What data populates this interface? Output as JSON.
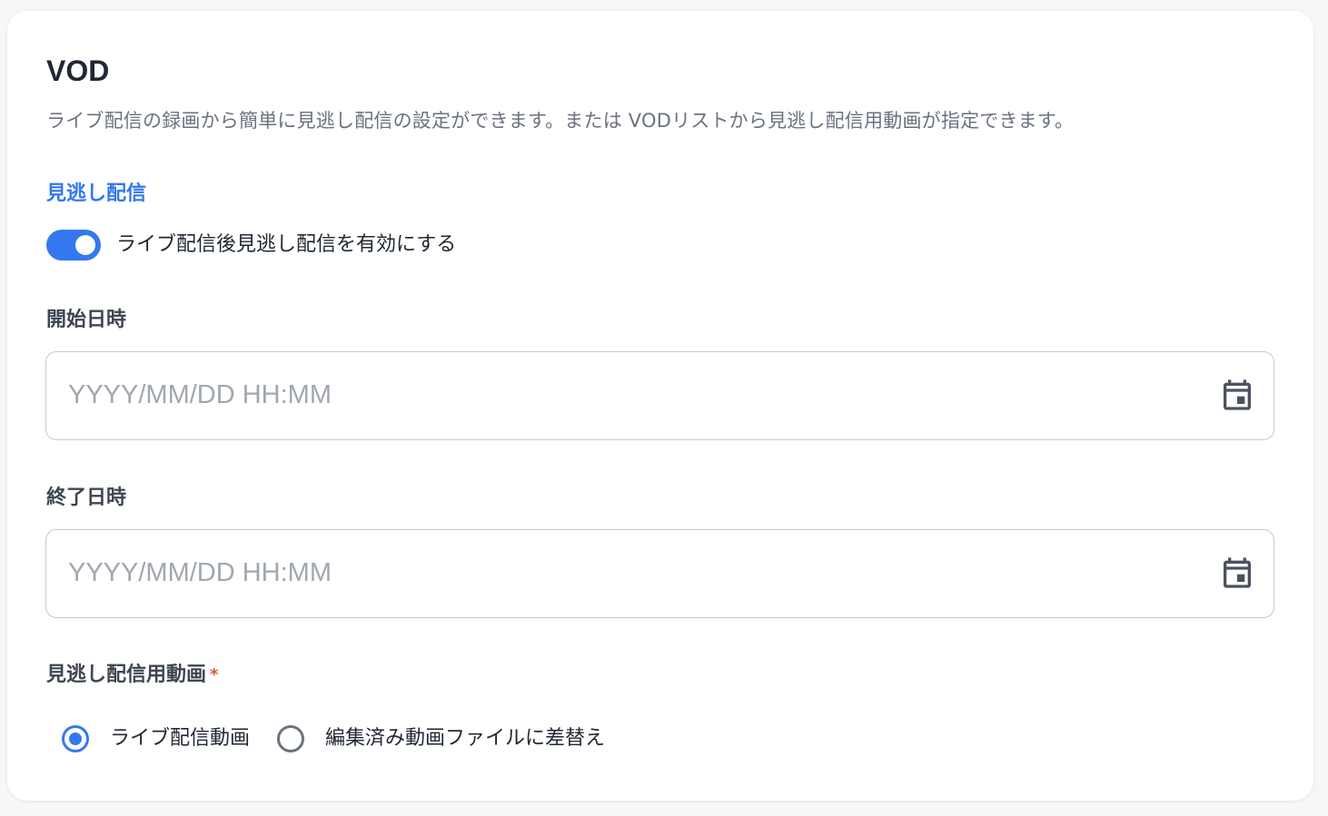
{
  "vod": {
    "title": "VOD",
    "description": "ライブ配信の録画から簡単に見逃し配信の設定ができます。または VODリストから見逃し配信用動画が指定できます。"
  },
  "catchup": {
    "section_label": "見逃し配信",
    "toggle_label": "ライブ配信後見逃し配信を有効にする",
    "toggle_on": true
  },
  "start": {
    "label": "開始日時",
    "placeholder": "YYYY/MM/DD HH:MM",
    "value": ""
  },
  "end": {
    "label": "終了日時",
    "placeholder": "YYYY/MM/DD HH:MM",
    "value": ""
  },
  "video": {
    "label": "見逃し配信用動画",
    "required_mark": "*",
    "options": [
      {
        "label": "ライブ配信動画",
        "selected": true
      },
      {
        "label": "編集済み動画ファイルに差替え",
        "selected": false
      }
    ]
  },
  "icons": {
    "calendar": "calendar-icon"
  },
  "colors": {
    "accent": "#3478f0",
    "required": "#e0542e",
    "text": "#1f2733",
    "muted": "#6b7280"
  }
}
